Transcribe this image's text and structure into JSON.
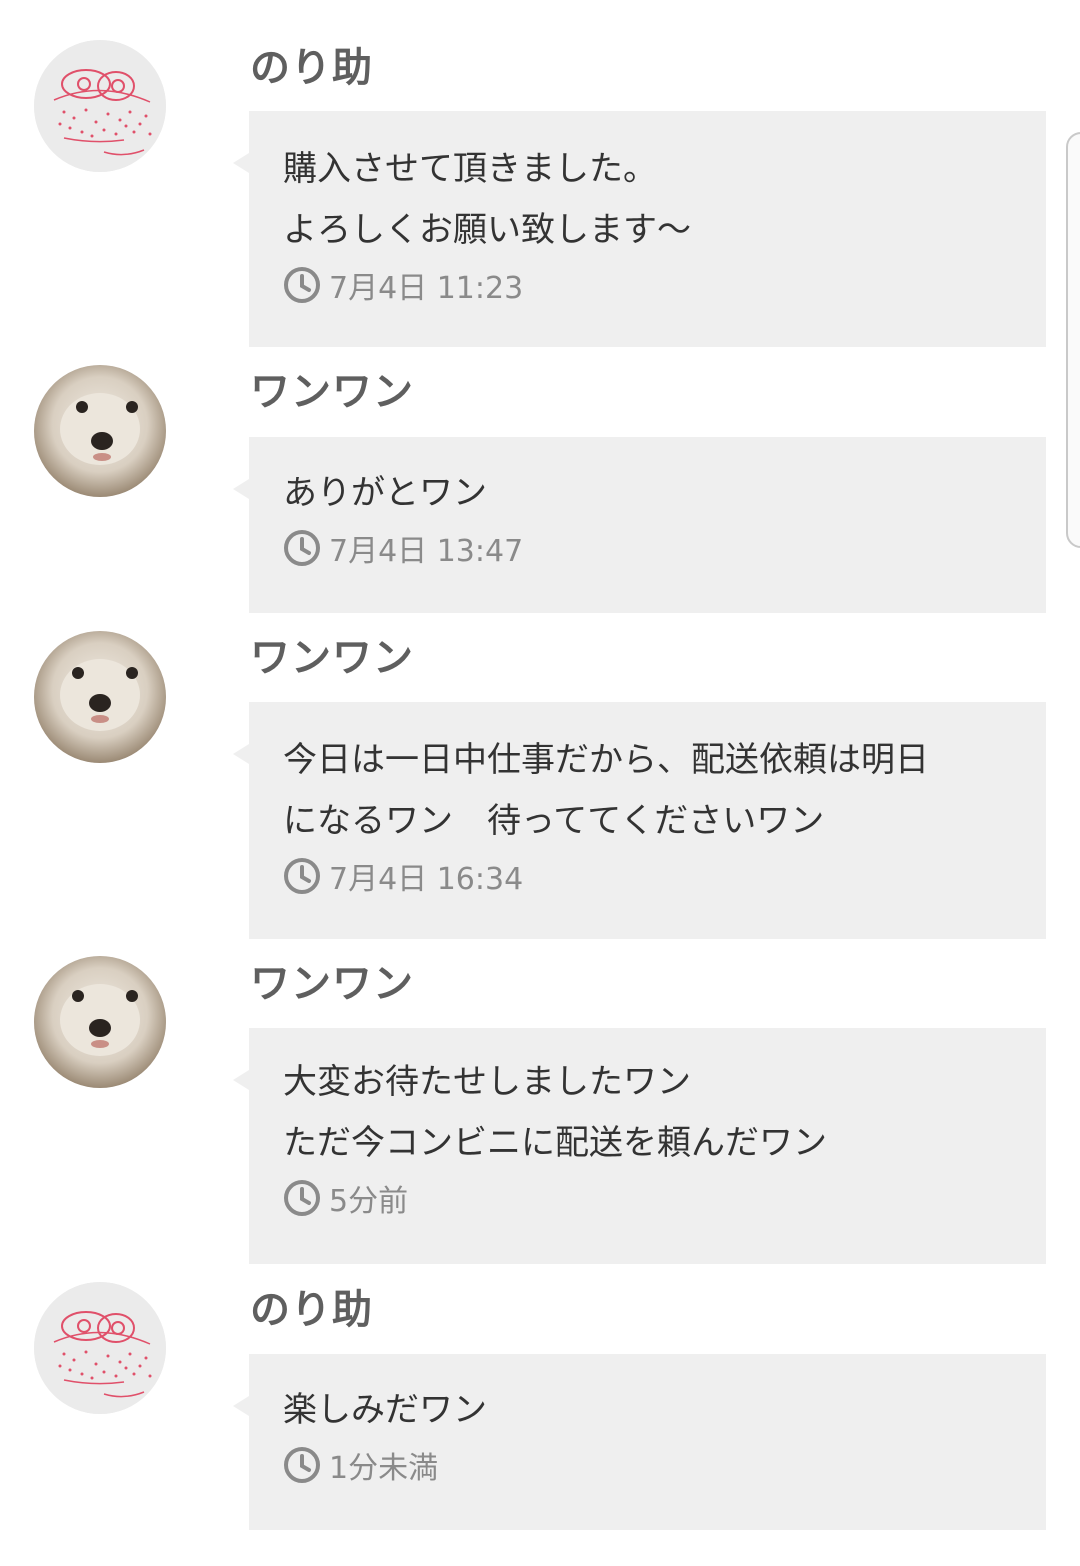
{
  "messages": [
    {
      "sender": "のり助",
      "avatar": "drawn-face-avatar",
      "text": "購入させて頂きました。\nよろしくお願い致します〜",
      "time": "7月4日 11:23"
    },
    {
      "sender": "ワンワン",
      "avatar": "dog-photo-avatar",
      "text": "ありがとワン",
      "time": "7月4日 13:47"
    },
    {
      "sender": "ワンワン",
      "avatar": "dog-photo-avatar",
      "text": "今日は一日中仕事だから、配送依頼は明日\nになるワン　待っててくださいワン",
      "time": "7月4日 16:34"
    },
    {
      "sender": "ワンワン",
      "avatar": "dog-photo-avatar",
      "text": "大変お待たせしましたワン\nただ今コンビニに配送を頼んだワン",
      "time": "5分前"
    },
    {
      "sender": "のり助",
      "avatar": "drawn-face-avatar",
      "text": "楽しみだワン",
      "time": "1分未満"
    }
  ],
  "icons": {
    "timestamp": "clock-icon"
  },
  "colors": {
    "bubble": "#efefef",
    "name": "#5f5f5f",
    "text": "#333333",
    "time": "#8a8a8a",
    "drawing_ink": "#e0506a"
  }
}
